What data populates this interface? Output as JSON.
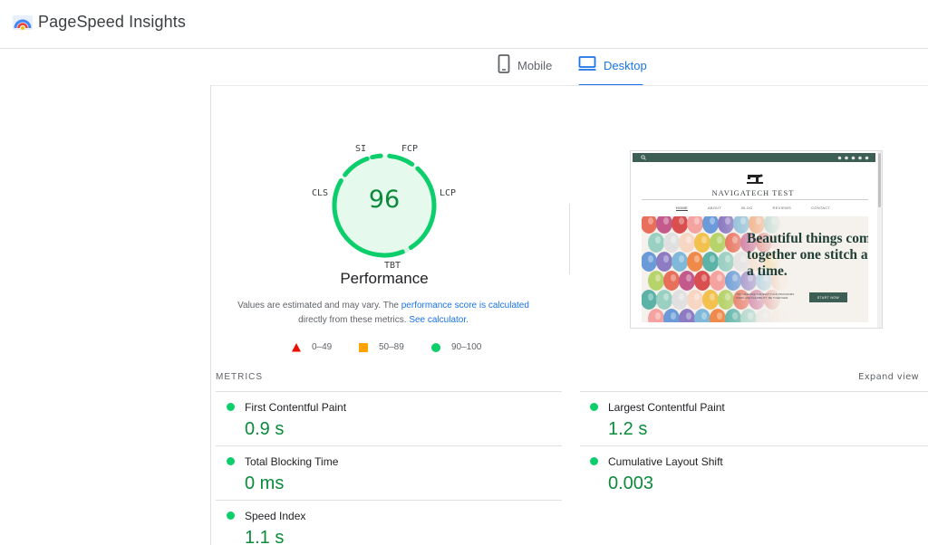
{
  "app": {
    "title": "PageSpeed Insights"
  },
  "tabs": [
    {
      "label": "Mobile",
      "icon": "phone-icon",
      "active": false
    },
    {
      "label": "Desktop",
      "icon": "desktop-icon",
      "active": true
    }
  ],
  "gauge": {
    "score": "96",
    "title": "Performance",
    "labels": {
      "si": "SI",
      "fcp": "FCP",
      "lcp": "LCP",
      "tbt": "TBT",
      "cls": "CLS"
    },
    "color_pass": "#0cce6b",
    "fill_fraction": 0.96
  },
  "description": {
    "part1": "Values are estimated and may vary. The ",
    "link1": "performance score is calculated",
    "part2": "directly from these metrics. ",
    "link2": "See calculator."
  },
  "legend": [
    {
      "shape": "triangle-icon",
      "range": "0–49",
      "color": "#eb0f00"
    },
    {
      "shape": "square-icon",
      "range": "50–89",
      "color": "#ffa400"
    },
    {
      "shape": "circle-icon",
      "range": "90–100",
      "color": "#0cce6b"
    }
  ],
  "screenshot": {
    "brand": "NAVIGATECH TEST",
    "nav": [
      "HOME",
      "ABOUT",
      "BLOG",
      "REVIEWS",
      "CONTACT"
    ],
    "headline": "Beautiful things come together one stitch at a time.",
    "subtext": "YOU DESERVE THE BEST THAN PROGRAMS WORK AND FLEXIBILITY, BE TOGETHER.",
    "button": "START NOW"
  },
  "metrics": {
    "title": "METRICS",
    "expand": "Expand view",
    "items": [
      {
        "label": "First Contentful Paint",
        "value": "0.9 s"
      },
      {
        "label": "Largest Contentful Paint",
        "value": "1.2 s"
      },
      {
        "label": "Total Blocking Time",
        "value": "0 ms"
      },
      {
        "label": "Cumulative Layout Shift",
        "value": "0.003"
      },
      {
        "label": "Speed Index",
        "value": "1.1 s"
      }
    ]
  }
}
